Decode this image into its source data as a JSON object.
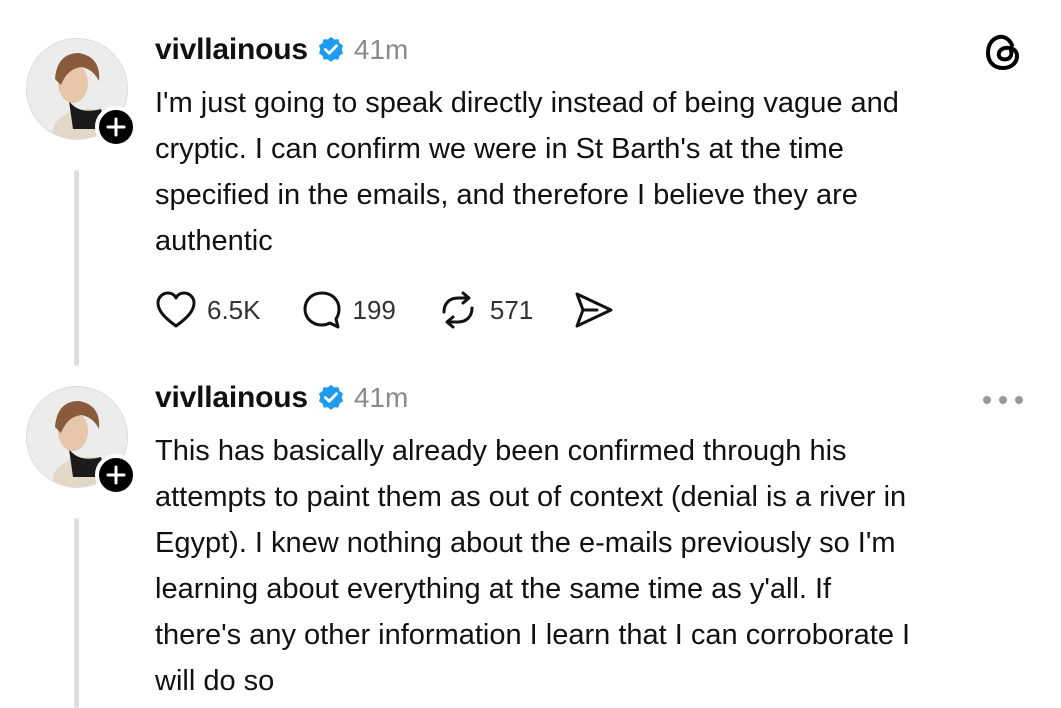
{
  "posts": [
    {
      "username": "vivllainous",
      "time": "41m",
      "text": "I'm just going to speak directly instead of being vague and\ncryptic. I can confirm we were in St Barth's at the time\nspecified in the emails, and therefore I believe they are\nauthentic",
      "likes": "6.5K",
      "replies": "199",
      "reposts": "571"
    },
    {
      "username": "vivllainous",
      "time": "41m",
      "text": "This has basically already been confirmed through his\nattempts to paint them as out of context (denial is a river in\nEgypt). I knew nothing about the e-mails previously so I'm\nlearning about everything at the same time as y'all. If\nthere's any other information I learn that I can corroborate I\nwill do so"
    }
  ],
  "colors": {
    "verified": "#1d9bf0",
    "thread_line": "#dedede",
    "time": "#8a8a8a"
  },
  "icons": {
    "app_logo": "threads-logo-icon",
    "like": "heart-icon",
    "reply": "comment-icon",
    "repost": "repost-icon",
    "share": "share-icon",
    "more": "more-options-icon",
    "follow": "plus-icon",
    "verified": "verified-badge-icon"
  }
}
